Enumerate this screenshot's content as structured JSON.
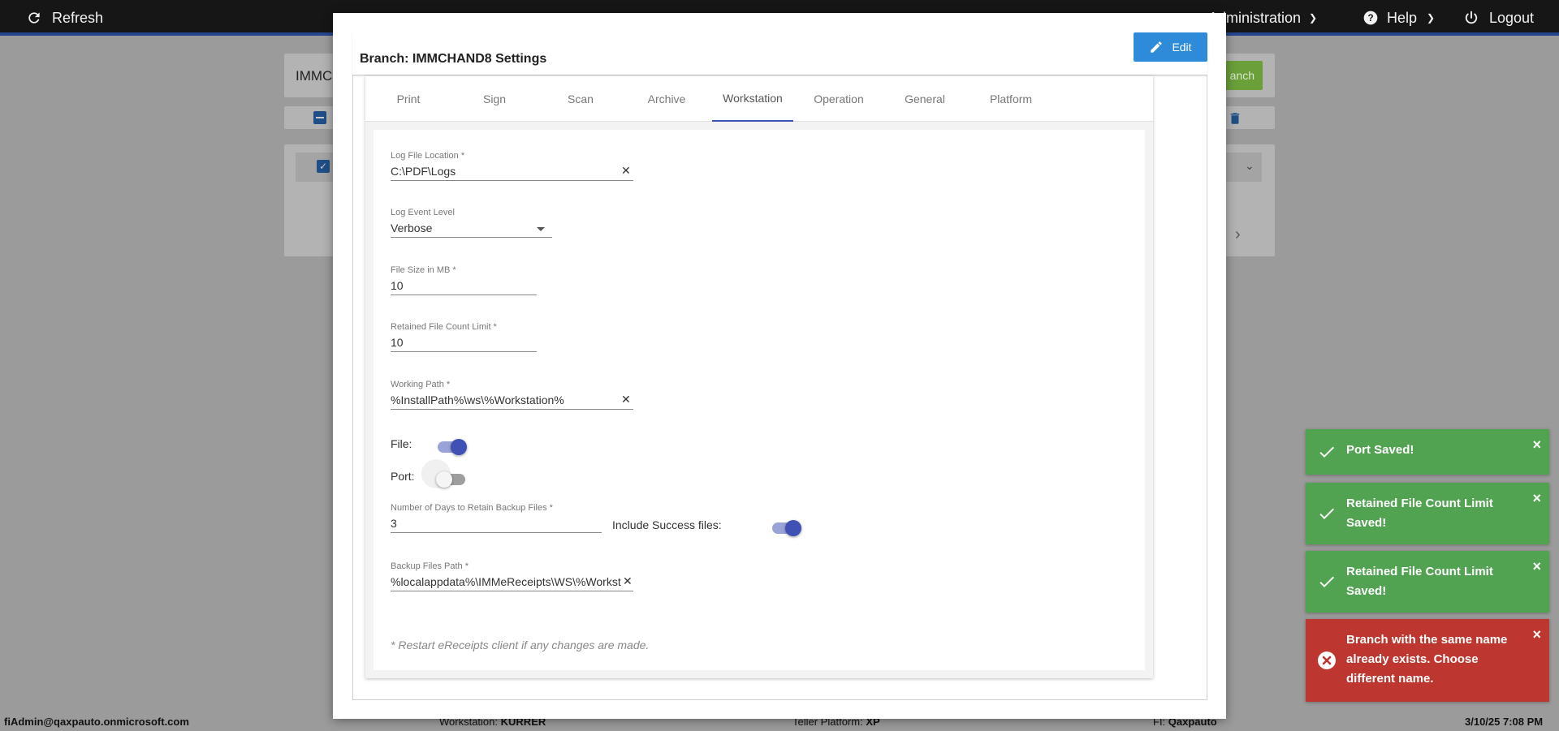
{
  "topbar": {
    "refresh_label": "Refresh",
    "administration_label": "Administration",
    "help_label": "Help",
    "logout_label": "Logout"
  },
  "background": {
    "search_text": "IMMC",
    "green_button_label": "anch"
  },
  "modal": {
    "title": "Branch: IMMCHAND8 Settings",
    "edit_label": "Edit",
    "tabs": [
      {
        "label": "Print"
      },
      {
        "label": "Sign"
      },
      {
        "label": "Scan"
      },
      {
        "label": "Archive"
      },
      {
        "label": "Workstation"
      },
      {
        "label": "Operation"
      },
      {
        "label": "General"
      },
      {
        "label": "Platform"
      }
    ],
    "active_tab": "Workstation",
    "form": {
      "log_file_location": {
        "label": "Log File Location *",
        "value": "C:\\PDF\\Logs"
      },
      "log_event_level": {
        "label": "Log Event Level",
        "value": "Verbose"
      },
      "file_size": {
        "label": "File Size in MB *",
        "value": "10"
      },
      "retained_count": {
        "label": "Retained File Count Limit *",
        "value": "10"
      },
      "working_path": {
        "label": "Working Path *",
        "value": "%InstallPath%\\ws\\%Workstation%"
      },
      "file_toggle": {
        "label": "File:",
        "on": true
      },
      "port_toggle": {
        "label": "Port:",
        "on": false
      },
      "retain_days": {
        "label": "Number of Days to Retain Backup Files *",
        "value": "3"
      },
      "include_success": {
        "label": "Include Success files:",
        "on": true
      },
      "backup_path": {
        "label": "Backup Files Path *",
        "value": "%localappdata%\\IMMeReceipts\\WS\\%Workstation%"
      },
      "note": "* Restart eReceipts client if any changes are made."
    }
  },
  "toasts": [
    {
      "type": "success",
      "text": "Port Saved!"
    },
    {
      "type": "success",
      "text": "Retained File Count Limit Saved!"
    },
    {
      "type": "success",
      "text": "Retained File Count Limit Saved!"
    },
    {
      "type": "error",
      "text": "Branch with the same name already exists. Choose different name."
    }
  ],
  "statusbar": {
    "user": "fiAdmin@qaxpauto.onmicrosoft.com",
    "workstation_label": "Workstation:",
    "workstation_value": "KURRER",
    "platform_label": "Teller Platform:",
    "platform_value": "XP",
    "fi_label": "FI:",
    "fi_value": "Qaxpauto",
    "datetime": "3/10/25 7:08 PM"
  },
  "colors": {
    "accent": "#3f51b5",
    "edit_button": "#2d8bd9",
    "toast_success": "#51a351",
    "toast_error": "#bd362f"
  }
}
